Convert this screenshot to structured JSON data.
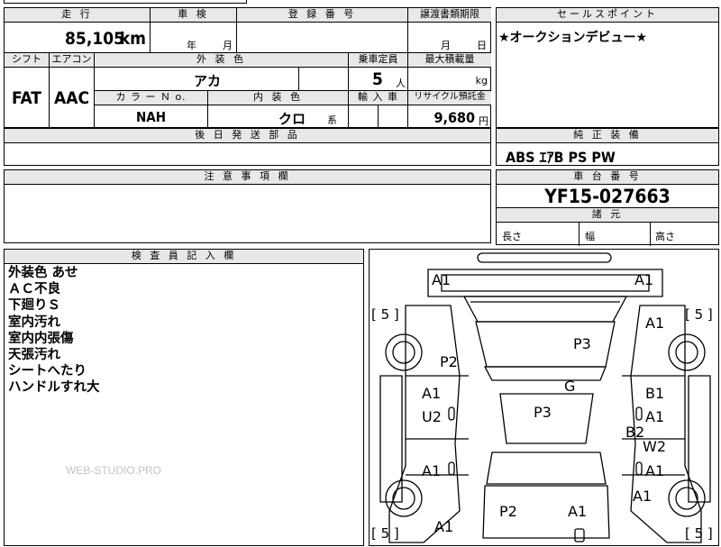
{
  "sheet": {
    "distance": {
      "header": "走 行",
      "value": "85,105",
      "unit": "km"
    },
    "inspection": {
      "header": "車 検",
      "year_label": "年",
      "month_label": "月"
    },
    "registration": {
      "header": "登 録 番 号"
    },
    "transfer_deadline": {
      "header": "譲渡書類期限",
      "month_label": "月",
      "day_label": "日"
    },
    "shift": {
      "header": "シフト",
      "value": "FAT"
    },
    "aircon": {
      "header": "エアコン",
      "value": "AAC"
    },
    "exterior_color": {
      "header": "外 装 色",
      "value": "アカ"
    },
    "capacity": {
      "header": "乗車定員",
      "value": "5",
      "unit": "人"
    },
    "max_load": {
      "header": "最大積載量",
      "unit": "kg"
    },
    "color_no": {
      "header": "カ ラ ー Ｎ o.",
      "value": "NAH"
    },
    "interior_color": {
      "header": "内 装 色",
      "value": "クロ",
      "suffix": "系"
    },
    "import": {
      "header": "輸 入 車"
    },
    "recycle": {
      "header": "リサイクル預託金",
      "value": "9,680",
      "unit": "円"
    },
    "later_parts": {
      "header": "後 日 発 送 部 品"
    },
    "notes": {
      "header": "注 意 事 項 欄"
    },
    "inspector": {
      "header": "検 査 員 記 入 欄",
      "lines": [
        "外装色 あせ",
        "ＡＣ不良",
        "下廻りＳ",
        "室内汚れ",
        "室内内張傷",
        "天張汚れ",
        "シートへたり",
        "ハンドルすれ大"
      ]
    },
    "sales_point": {
      "header": "セールスポイント",
      "value": "★オークションデビュー★"
    },
    "equipment": {
      "header": "純 正 装 備",
      "value": "ABS ｴｱB PS PW"
    },
    "chassis": {
      "header": "車 台 番 号",
      "value": "YF15-027663"
    },
    "dimensions": {
      "header": "諸 元",
      "length": "長さ",
      "width": "幅",
      "height": "高さ"
    },
    "watermark": "WEB-STUDIO.PRO"
  },
  "diagram": {
    "marks": [
      "A1",
      "A1",
      "A1",
      "P3",
      "P2",
      "A1",
      "G",
      "B1",
      "U2",
      "P3",
      "A1",
      "B2",
      "W2",
      "A1",
      "A1",
      "A1",
      "P2",
      "A1",
      "A1"
    ],
    "brackets": [
      "[ 5 ]",
      "[ 5 ]",
      "[ 5 ]",
      "[ 5 ]"
    ]
  }
}
